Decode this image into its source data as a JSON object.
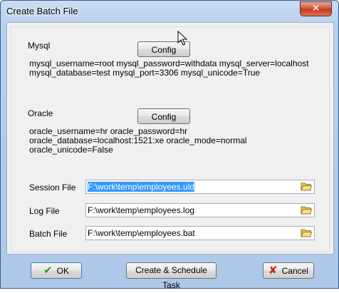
{
  "window": {
    "title": "Create Batch File",
    "close_symbol": "✕"
  },
  "mysql": {
    "label": "Mysql",
    "config_button": "Config",
    "settings_line1": "mysql_username=root mysql_password=withdata mysql_server=localhost",
    "settings_line2": "mysql_database=test mysql_port=3306 mysql_unicode=True"
  },
  "oracle": {
    "label": "Oracle",
    "config_button": "Config",
    "settings_line1": "oracle_username=hr oracle_password=hr",
    "settings_line2": "oracle_database=localhost:1521:xe oracle_mode=normal",
    "settings_line3": "oracle_unicode=False"
  },
  "files": {
    "session_label": "Session File",
    "session_value": "F:\\work\\temp\\employees.uld",
    "log_label": "Log File",
    "log_value": "F:\\work\\temp\\employees.log",
    "batch_label": "Batch File",
    "batch_value": "F:\\work\\temp\\employees.bat"
  },
  "buttons": {
    "ok": "OK",
    "create_schedule": "Create & Schedule Task",
    "cancel": "Cancel"
  },
  "colors": {
    "selection": "#3399ff",
    "title_gradient": "#b7cfee",
    "close": "#c7381c"
  },
  "icons": [
    "folder-icon",
    "check-icon",
    "cancel-x-icon",
    "cursor-icon"
  ]
}
